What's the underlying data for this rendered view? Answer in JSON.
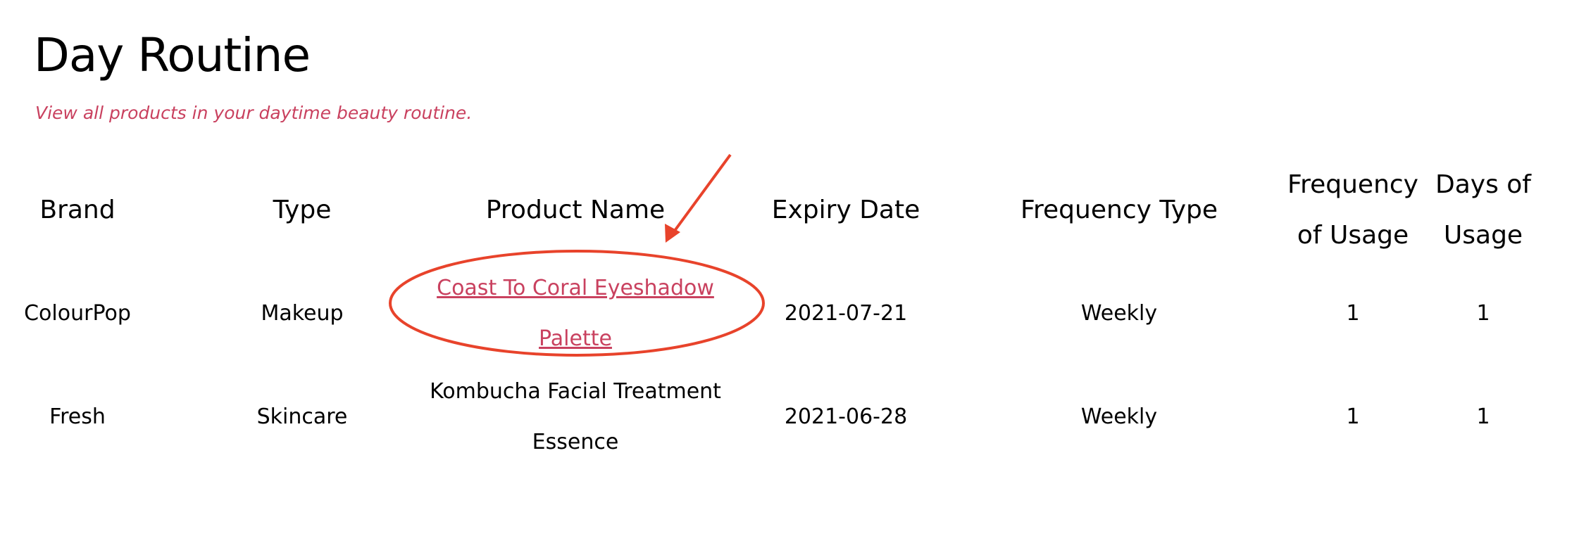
{
  "page": {
    "title": "Day Routine",
    "subtitle": "View all products in your daytime beauty routine."
  },
  "table": {
    "headers": [
      "Brand",
      "Type",
      "Product Name",
      "Expiry Date",
      "Frequency Type",
      "Frequency of Usage",
      "Days of Usage"
    ],
    "rows": [
      {
        "brand": "ColourPop",
        "type": "Makeup",
        "product": "Coast To Coral Eyeshadow Palette",
        "expiry": "2021-07-21",
        "freq_type": "Weekly",
        "freq_usage": "1",
        "days_usage": "1"
      },
      {
        "brand": "Fresh",
        "type": "Skincare",
        "product": "Kombucha Facial Treatment Essence",
        "expiry": "2021-06-28",
        "freq_type": "Weekly",
        "freq_usage": "1",
        "days_usage": "1"
      }
    ]
  },
  "colors": {
    "accent": "#c9415f",
    "annotation": "#e8432b"
  }
}
